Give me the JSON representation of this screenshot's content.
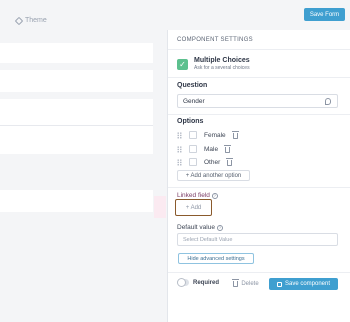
{
  "topbar": {
    "theme_label": "Theme",
    "save_form_label": "Save Form"
  },
  "panel": {
    "header": "COMPONENT SETTINGS",
    "component": {
      "title": "Multiple Choices",
      "subtitle": "Ask for a several choices",
      "icon": "check-icon"
    },
    "question": {
      "label": "Question",
      "value": "Gender"
    },
    "options": {
      "label": "Options",
      "items": [
        "Female",
        "Male",
        "Other"
      ],
      "add_label": "+ Add another option"
    },
    "linked_field": {
      "label": "Linked field",
      "add_label": "+ Add"
    },
    "default_value": {
      "label": "Default value",
      "placeholder": "Select Default Value"
    },
    "hide_advanced_label": "Hide advanced settings",
    "required_label": "Required",
    "delete_label": "Delete",
    "save_component_label": "Save component"
  },
  "colors": {
    "primary": "#3f9fd0",
    "success": "#5cc08e",
    "linked_label": "#7b3c66",
    "focus_border": "#8a5a2c"
  }
}
